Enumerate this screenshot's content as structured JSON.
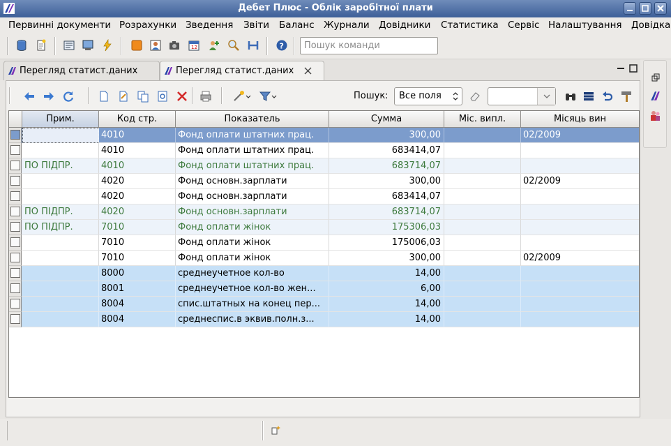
{
  "window": {
    "title": "Дебет Плюс - Облік заробітної плати",
    "icon": "app-logo-icon"
  },
  "menu": [
    "Первинні документи",
    "Розрахунки",
    "Зведення",
    "Звіти",
    "Баланс",
    "Журнали",
    "Довідники",
    "Статистика",
    "Сервіс",
    "Налаштування",
    "Довідка"
  ],
  "toolbar": {
    "command_search_placeholder": "Пошук команди",
    "icons": [
      "database-icon",
      "new-document-icon",
      "report-icon",
      "print-preview-icon",
      "lightning-icon",
      "orange-box-icon",
      "person-card-icon",
      "camera-icon",
      "calendar-icon",
      "add-user-icon",
      "magnifier-icon",
      "tools-icon",
      "help-icon"
    ]
  },
  "tabs": [
    {
      "label": "Перегляд статист.даних",
      "active": false
    },
    {
      "label": "Перегляд статист.даних",
      "active": true,
      "closable": true
    }
  ],
  "panel_toolbar": {
    "search_label": "Пошук:",
    "search_field_value": "Все поля",
    "search_text_value": ""
  },
  "grid": {
    "columns": [
      "Прим.",
      "Код стр.",
      "Показатель",
      "Сумма",
      "Міс. випл.",
      "Місяць вин"
    ],
    "rows": [
      {
        "note": "",
        "code": "4010",
        "name": "Фонд оплати штатних прац.",
        "sum": "300,00",
        "pay_month": "",
        "month": "02/2009",
        "style": "selected"
      },
      {
        "note": "",
        "code": "4010",
        "name": "Фонд оплати штатних прац.",
        "sum": "683414,07",
        "pay_month": "",
        "month": "",
        "style": "plain"
      },
      {
        "note": "ПО ПІДПР.",
        "code": "4010",
        "name": "Фонд оплати штатних прац.",
        "sum": "683714,07",
        "pay_month": "",
        "month": "",
        "style": "total"
      },
      {
        "note": "",
        "code": "4020",
        "name": "Фонд основн.зарплати",
        "sum": "300,00",
        "pay_month": "",
        "month": "02/2009",
        "style": "plain"
      },
      {
        "note": "",
        "code": "4020",
        "name": "Фонд основн.зарплати",
        "sum": "683414,07",
        "pay_month": "",
        "month": "",
        "style": "plain"
      },
      {
        "note": "ПО ПІДПР.",
        "code": "4020",
        "name": "Фонд основн.зарплати",
        "sum": "683714,07",
        "pay_month": "",
        "month": "",
        "style": "total"
      },
      {
        "note": "ПО ПІДПР.",
        "code": "7010",
        "name": "Фонд оплати жінок",
        "sum": "175306,03",
        "pay_month": "",
        "month": "",
        "style": "total"
      },
      {
        "note": "",
        "code": "7010",
        "name": "Фонд оплати жінок",
        "sum": "175006,03",
        "pay_month": "",
        "month": "",
        "style": "plain"
      },
      {
        "note": "",
        "code": "7010",
        "name": "Фонд оплати жінок",
        "sum": "300,00",
        "pay_month": "",
        "month": "02/2009",
        "style": "plain"
      },
      {
        "note": "",
        "code": "8000",
        "name": "среднеучетное кол-во",
        "sum": "14,00",
        "pay_month": "",
        "month": "",
        "style": "blue"
      },
      {
        "note": "",
        "code": "8001",
        "name": "среднеучетное кол-во жен...",
        "sum": "6,00",
        "pay_month": "",
        "month": "",
        "style": "blue"
      },
      {
        "note": "",
        "code": "8004",
        "name": "спис.штатных на конец пер...",
        "sum": "14,00",
        "pay_month": "",
        "month": "",
        "style": "blue"
      },
      {
        "note": "",
        "code": "8004",
        "name": "среднеспис.в эквив.полн.з...",
        "sum": "14,00",
        "pay_month": "",
        "month": "",
        "style": "blue"
      }
    ]
  },
  "colors": {
    "selected_row": "#7c9ccc",
    "total_row_bg": "#edf3fa",
    "total_row_text": "#3d7a3d",
    "blue_row": "#c6e0f7",
    "title_bar": "#4a6aa3"
  }
}
